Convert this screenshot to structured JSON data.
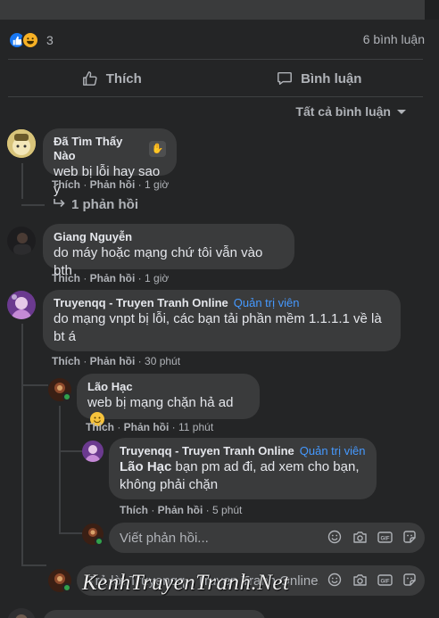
{
  "post": {
    "reaction_count": "3",
    "comment_count": "6 bình luận",
    "like_label": "Thích",
    "comment_label": "Bình luận",
    "filter_label": "Tất cả bình luận"
  },
  "comments": [
    {
      "author": "Đã Tìm Thấy Nào",
      "text": "web bị lỗi hay sao ý",
      "like": "Thích",
      "reply": "Phản hồi",
      "time": "1 giờ",
      "replies_link": "1 phản hồi"
    },
    {
      "author": "Giang Nguyễn",
      "text": "do máy hoặc mạng chứ tôi vẫn vào bth",
      "like": "Thích",
      "reply": "Phản hồi",
      "time": "1 giờ"
    },
    {
      "author": "Truyenqq - Truyen Tranh Online",
      "badge": "Quản trị viên",
      "text_line1": "do mạng vnpt bị lỗi, các bạn tải phần mềm 1.1.1.1 về là",
      "text_line2": "bt á",
      "like": "Thích",
      "reply": "Phản hồi",
      "time": "30 phút"
    }
  ],
  "replies": [
    {
      "author": "Lão Hạc",
      "text": "web bị mạng chặn hả ad",
      "like": "Thích",
      "reply": "Phản hồi",
      "time": "11 phút"
    },
    {
      "author": "Truyenqq - Truyen Tranh Online",
      "badge": "Quản trị viên",
      "mention": "Lão Hạc",
      "text_line1": " bạn pm ad đi, ad xem cho bạn,",
      "text_line2": "không phải chặn",
      "like": "Thích",
      "reply": "Phản hồi",
      "time": "5 phút"
    }
  ],
  "reply_input": {
    "placeholder": "Viết phản hồi..."
  },
  "bottom_input": {
    "placeholder": "Trả lời Truyenqq - Truyen Tranh Online..."
  },
  "watermark": "KenhTruyenTranh.Net",
  "colors": {
    "background": "#242526",
    "bubble": "#3a3b3c",
    "text": "#e4e6eb",
    "muted": "#b0b3b8",
    "admin_badge": "#4599ff",
    "online": "#31a24c"
  }
}
